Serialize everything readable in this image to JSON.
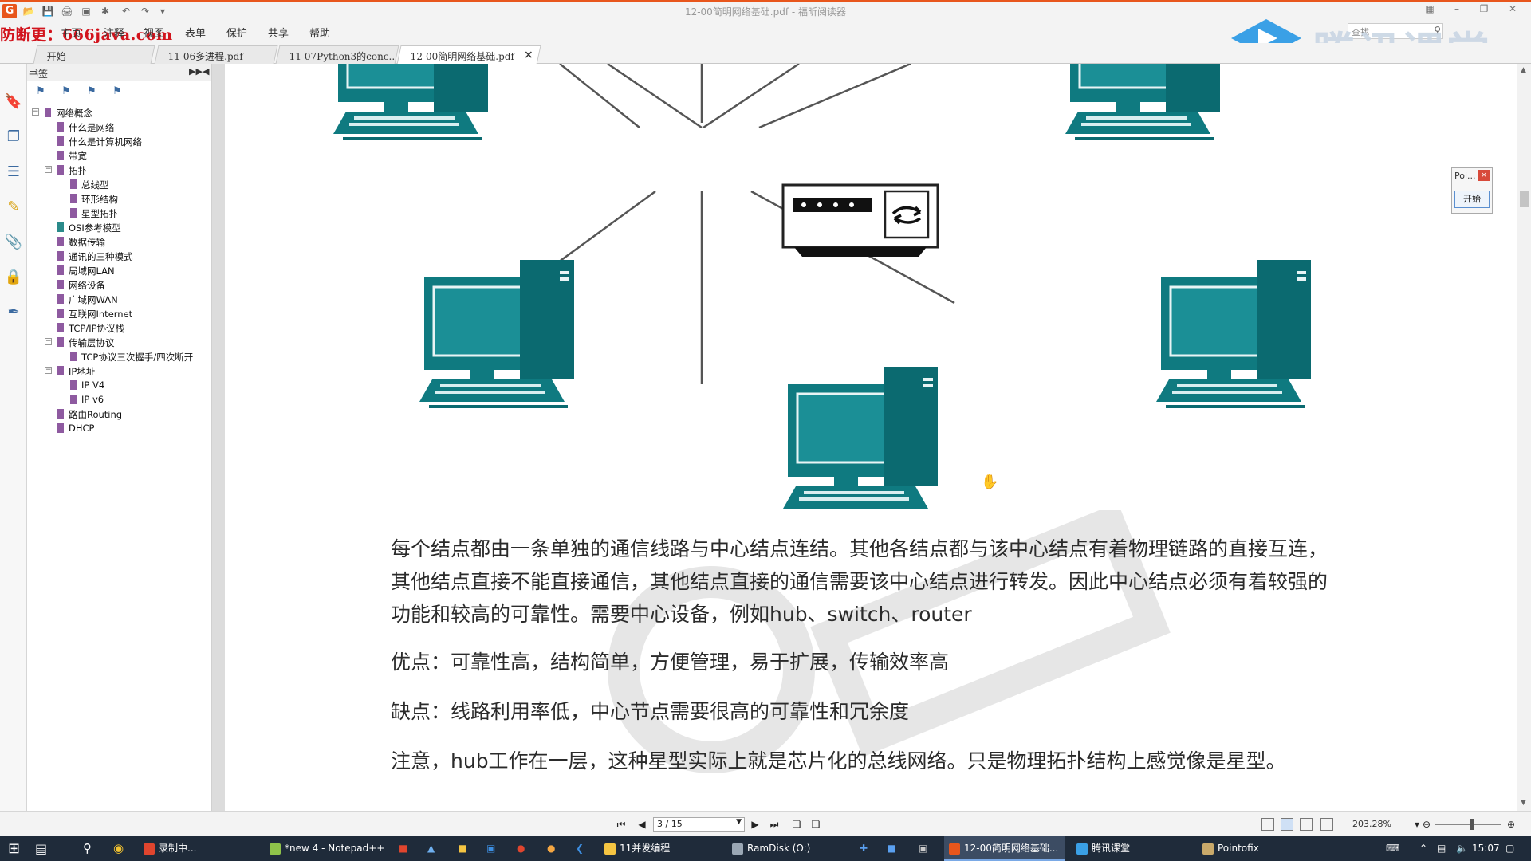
{
  "window": {
    "title": "12-00简明网络基础.pdf - 福昕阅读器",
    "app_logo": "G"
  },
  "menubar": {
    "watermark": "防断更：666java.com",
    "items": [
      "主页",
      "注释",
      "视图",
      "表单",
      "保护",
      "共享",
      "帮助"
    ],
    "search_placeholder": "查找"
  },
  "brand": {
    "text": "腾讯课堂"
  },
  "tabs": [
    {
      "label": "开始"
    },
    {
      "label": "11-06多进程.pdf"
    },
    {
      "label": "11-07Python3的conc..."
    },
    {
      "label": "12-00简明网络基础.pdf",
      "close": "×"
    }
  ],
  "bookmarks": {
    "title": "书签",
    "items": [
      {
        "label": "网络概念",
        "level": 0,
        "toggle": "−"
      },
      {
        "label": "什么是网络",
        "level": 1
      },
      {
        "label": "什么是计算机网络",
        "level": 1
      },
      {
        "label": "带宽",
        "level": 1
      },
      {
        "label": "拓扑",
        "level": 1,
        "toggle": "−"
      },
      {
        "label": "总线型",
        "level": 2
      },
      {
        "label": "环形结构",
        "level": 2
      },
      {
        "label": "星型拓扑",
        "level": 2
      },
      {
        "label": "OSI参考模型",
        "level": 1,
        "teal": true
      },
      {
        "label": "数据传输",
        "level": 1
      },
      {
        "label": "通讯的三种模式",
        "level": 1
      },
      {
        "label": "局域网LAN",
        "level": 1
      },
      {
        "label": "网络设备",
        "level": 1
      },
      {
        "label": "广域网WAN",
        "level": 1
      },
      {
        "label": "互联网Internet",
        "level": 1
      },
      {
        "label": "TCP/IP协议栈",
        "level": 1
      },
      {
        "label": "传输层协议",
        "level": 1,
        "toggle": "−"
      },
      {
        "label": "TCP协议三次握手/四次断开",
        "level": 2
      },
      {
        "label": "IP地址",
        "level": 1,
        "toggle": "−"
      },
      {
        "label": "IP V4",
        "level": 2
      },
      {
        "label": "IP v6",
        "level": 2
      },
      {
        "label": "路由Routing",
        "level": 1
      },
      {
        "label": "DHCP",
        "level": 1
      }
    ]
  },
  "document": {
    "paragraphs": [
      "每个结点都由一条单独的通信线路与中心结点连结。其他各结点都与该中心结点有着物理链路的直接互连，其他结点直接不能直接通信，其他结点直接的通信需要该中心结点进行转发。因此中心结点必须有着较强的功能和较高的可靠性。需要中心设备，例如hub、switch、router",
      "优点：可靠性高，结构简单，方便管理，易于扩展，传输效率高",
      "缺点：线路利用率低，中心节点需要很高的可靠性和冗余度",
      "注意，hub工作在一层，这种星型实际上就是芯片化的总线网络。只是物理拓扑结构上感觉像是星型。"
    ],
    "diagram_colors": {
      "computer": "#0f7a80",
      "screen": "#1a8c92",
      "line": "#555555"
    }
  },
  "pointofix": {
    "title": "Poi...",
    "close": "×",
    "start": "开始"
  },
  "navbar": {
    "page": "3 / 15",
    "zoom": "203.28%"
  },
  "taskbar": {
    "items": [
      {
        "label": "录制中..."
      },
      {
        "label": "*new 4 - Notepad++"
      },
      {
        "label": "11并发编程"
      },
      {
        "label": "RamDisk (O:)"
      },
      {
        "label": "12-00简明网络基础..."
      },
      {
        "label": "腾讯课堂"
      },
      {
        "label": "Pointofix"
      }
    ],
    "time": "15:07"
  }
}
